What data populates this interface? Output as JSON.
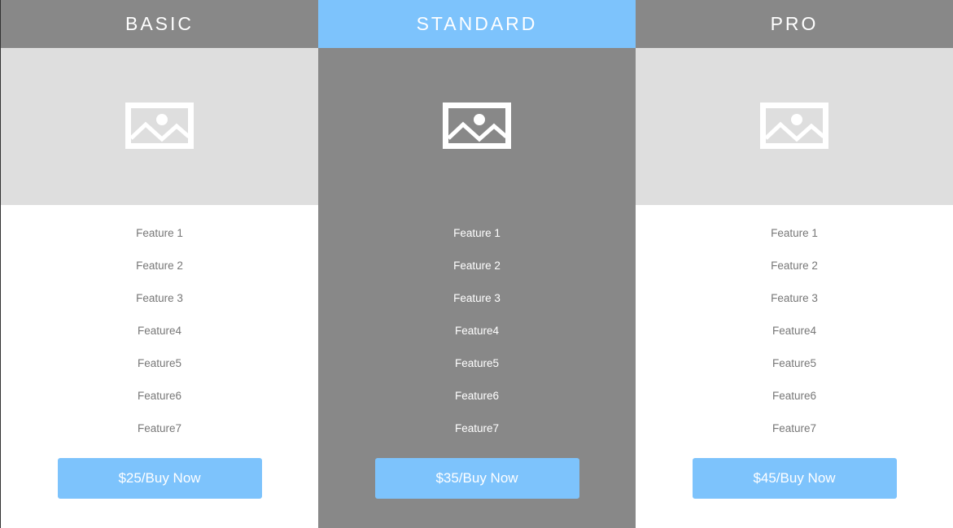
{
  "colors": {
    "accent": "#7dc3fc",
    "header_gray": "#888888",
    "image_bg": "#dedede",
    "text_gray": "#777777"
  },
  "plans": [
    {
      "name": "BASIC",
      "featured": false,
      "icon": "image-placeholder-icon",
      "features": [
        "Feature 1",
        "Feature 2",
        "Feature 3",
        "Feature4",
        "Feature5",
        "Feature6",
        "Feature7"
      ],
      "button": "$25/Buy Now"
    },
    {
      "name": "STANDARD",
      "featured": true,
      "icon": "image-placeholder-icon",
      "features": [
        "Feature 1",
        "Feature 2",
        "Feature 3",
        "Feature4",
        "Feature5",
        "Feature6",
        "Feature7"
      ],
      "button": "$35/Buy Now"
    },
    {
      "name": "PRO",
      "featured": false,
      "icon": "image-placeholder-icon",
      "features": [
        "Feature 1",
        "Feature 2",
        "Feature 3",
        "Feature4",
        "Feature5",
        "Feature6",
        "Feature7"
      ],
      "button": "$45/Buy Now"
    }
  ]
}
